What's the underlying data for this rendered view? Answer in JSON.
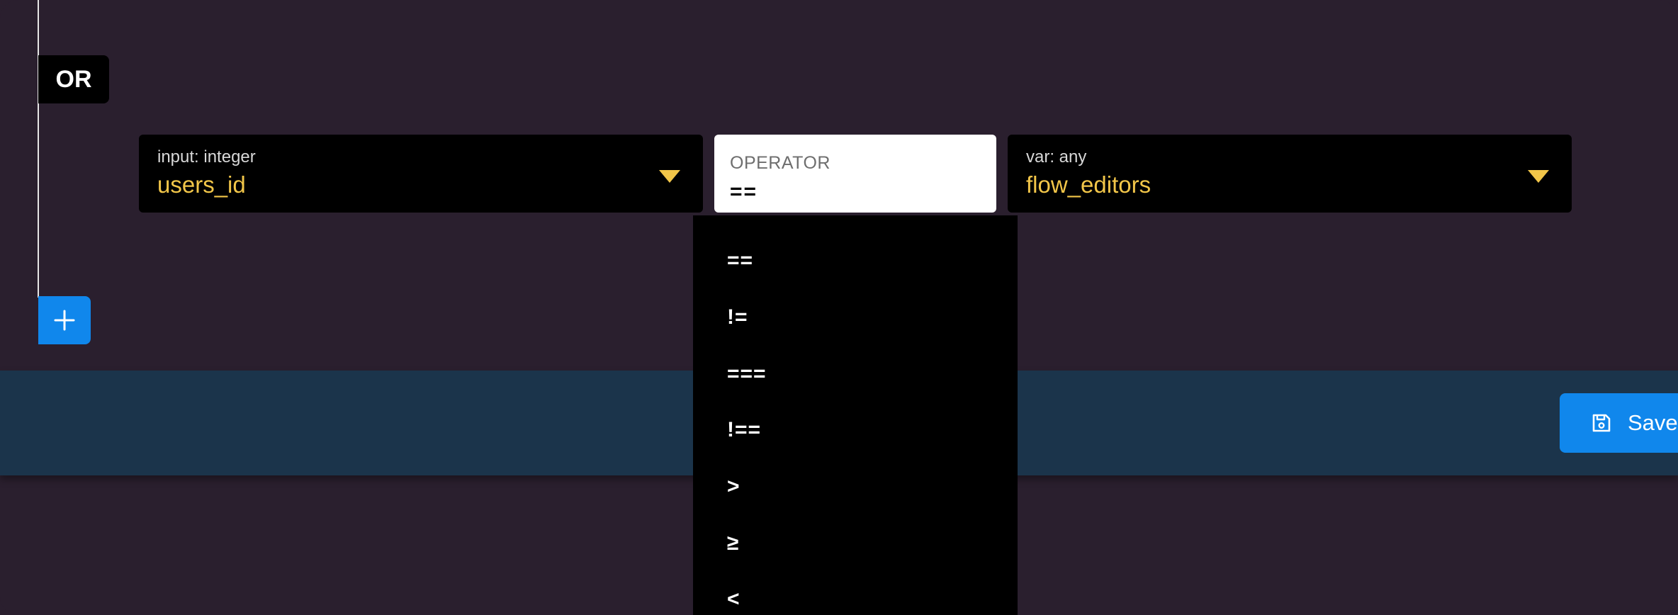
{
  "condition_group": {
    "logic_badge": "OR"
  },
  "input_select": {
    "caption": "input: integer",
    "value": "users_id",
    "icon": "caret-down-icon"
  },
  "operator_field": {
    "label": "OPERATOR",
    "value": "=="
  },
  "var_select": {
    "caption": "var: any",
    "value": "flow_editors",
    "icon": "caret-down-icon"
  },
  "operator_dropdown": {
    "options": [
      "==",
      "!=",
      "===",
      "!==",
      ">",
      "≥",
      "<"
    ]
  },
  "add_condition": {
    "icon": "plus-icon"
  },
  "footer": {
    "save_label": "Save",
    "save_icon": "floppy-disk-icon"
  },
  "colors": {
    "background": "#2a1f2e",
    "accent_value": "#f2c649",
    "button_blue": "#1087ec",
    "footer_bar": "#1b344b"
  }
}
